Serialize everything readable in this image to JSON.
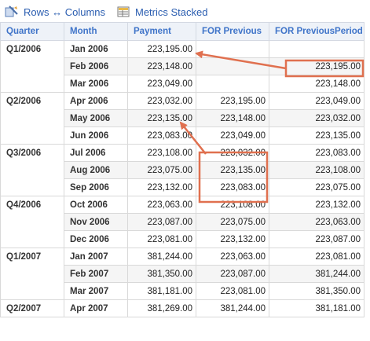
{
  "toolbar": {
    "rows_columns_label": "Rows ↔ Columns",
    "metrics_stacked_label": "Metrics Stacked"
  },
  "table": {
    "headers": [
      "Quarter",
      "Month",
      "Payment",
      "FOR Previous",
      "FOR PreviousPeriod"
    ],
    "groups": [
      {
        "quarter": "Q1/2006",
        "rows": [
          {
            "month": "Jan 2006",
            "payment": "223,195.00",
            "for_previous": "",
            "for_previous_period": ""
          },
          {
            "month": "Feb 2006",
            "payment": "223,148.00",
            "for_previous": "",
            "for_previous_period": "223,195.00"
          },
          {
            "month": "Mar 2006",
            "payment": "223,049.00",
            "for_previous": "",
            "for_previous_period": "223,148.00"
          }
        ]
      },
      {
        "quarter": "Q2/2006",
        "rows": [
          {
            "month": "Apr 2006",
            "payment": "223,032.00",
            "for_previous": "223,195.00",
            "for_previous_period": "223,049.00"
          },
          {
            "month": "May 2006",
            "payment": "223,135.00",
            "for_previous": "223,148.00",
            "for_previous_period": "223,032.00"
          },
          {
            "month": "Jun 2006",
            "payment": "223,083.00",
            "for_previous": "223,049.00",
            "for_previous_period": "223,135.00"
          }
        ]
      },
      {
        "quarter": "Q3/2006",
        "rows": [
          {
            "month": "Jul 2006",
            "payment": "223,108.00",
            "for_previous": "223,032.00",
            "for_previous_period": "223,083.00"
          },
          {
            "month": "Aug 2006",
            "payment": "223,075.00",
            "for_previous": "223,135.00",
            "for_previous_period": "223,108.00"
          },
          {
            "month": "Sep 2006",
            "payment": "223,132.00",
            "for_previous": "223,083.00",
            "for_previous_period": "223,075.00"
          }
        ]
      },
      {
        "quarter": "Q4/2006",
        "rows": [
          {
            "month": "Oct 2006",
            "payment": "223,063.00",
            "for_previous": "223,108.00",
            "for_previous_period": "223,132.00"
          },
          {
            "month": "Nov 2006",
            "payment": "223,087.00",
            "for_previous": "223,075.00",
            "for_previous_period": "223,063.00"
          },
          {
            "month": "Dec 2006",
            "payment": "223,081.00",
            "for_previous": "223,132.00",
            "for_previous_period": "223,087.00"
          }
        ]
      },
      {
        "quarter": "Q1/2007",
        "rows": [
          {
            "month": "Jan 2007",
            "payment": "381,244.00",
            "for_previous": "223,063.00",
            "for_previous_period": "223,081.00"
          },
          {
            "month": "Feb 2007",
            "payment": "381,350.00",
            "for_previous": "223,087.00",
            "for_previous_period": "381,244.00"
          },
          {
            "month": "Mar 2007",
            "payment": "381,181.00",
            "for_previous": "223,081.00",
            "for_previous_period": "381,350.00"
          }
        ]
      },
      {
        "quarter": "Q2/2007",
        "rows": [
          {
            "month": "Apr 2007",
            "payment": "381,269.00",
            "for_previous": "381,244.00",
            "for_previous_period": "381,181.00"
          }
        ]
      }
    ]
  },
  "annotations": {
    "color": "#e0704f"
  },
  "colors": {
    "link": "#2a5db0",
    "header_text": "#3f74c9",
    "header_bg": "#eef2f8",
    "alt_row_bg": "#f5f5f5"
  },
  "icons": [
    "swap-rows-columns-icon",
    "metrics-stacked-icon"
  ]
}
